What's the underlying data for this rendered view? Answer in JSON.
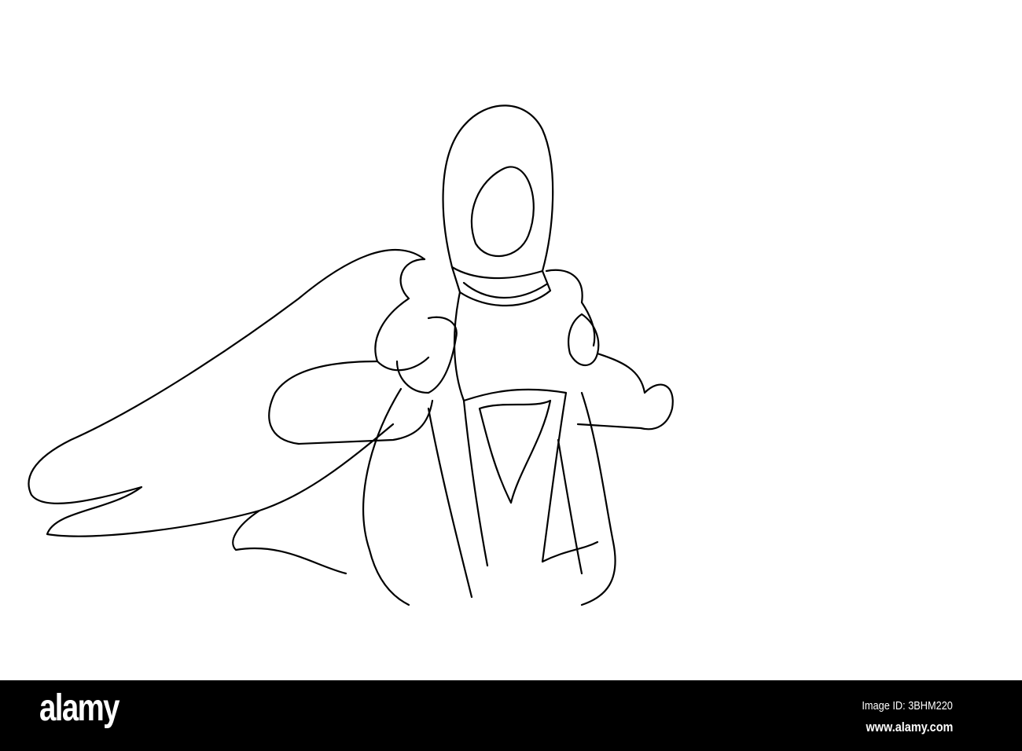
{
  "footer": {
    "logo": "alamy",
    "image_id": "Image ID: 3BHM220",
    "url": "www.alamy.com"
  }
}
